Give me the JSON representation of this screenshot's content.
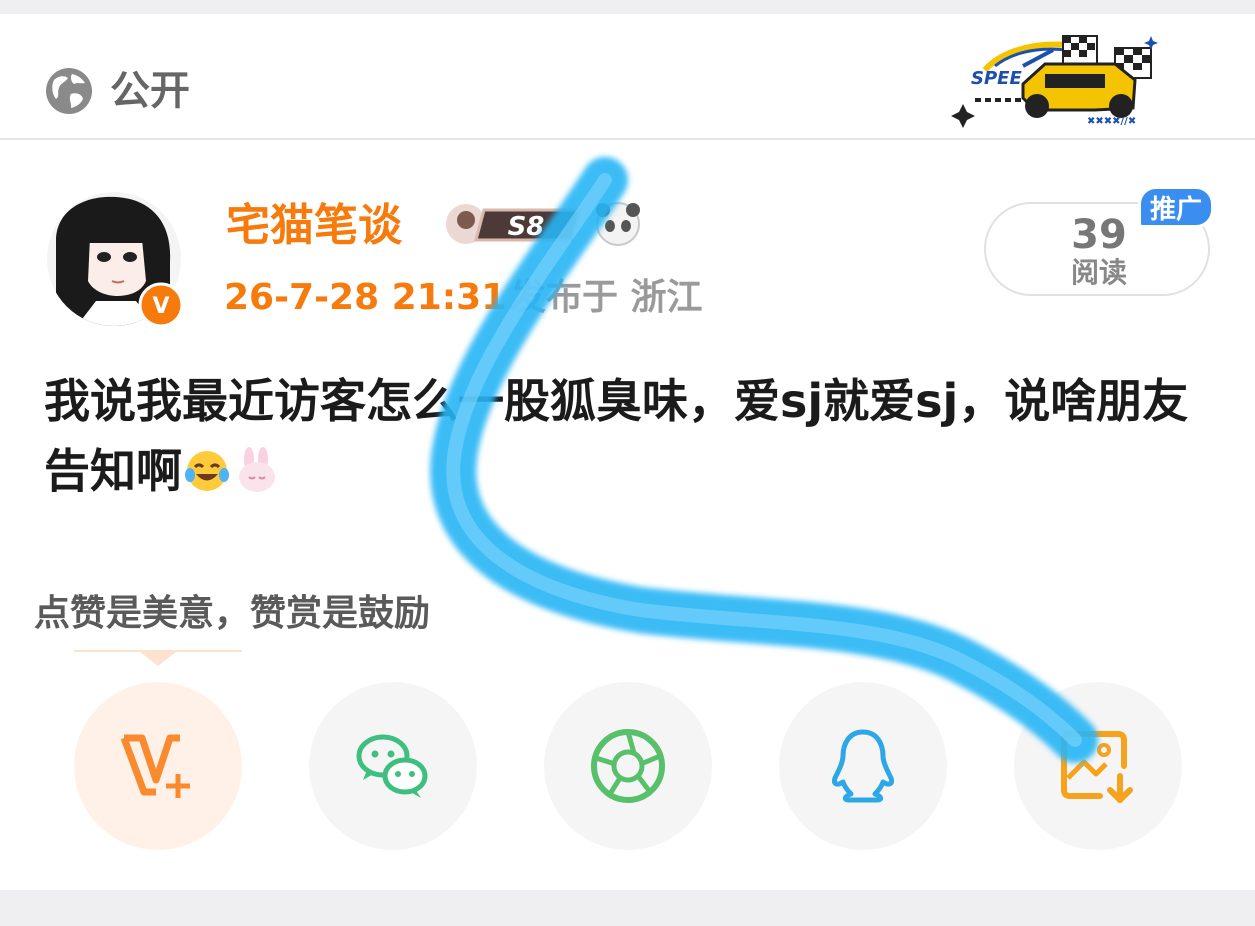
{
  "header": {
    "visibility_label": "公开",
    "globe_icon": "globe-icon",
    "logo_icon": "race-car-logo",
    "logo_text": "SPEE"
  },
  "author": {
    "name": "宅猫笔谈",
    "level_badge": "S8",
    "time": "26-7-28 21:31",
    "location": "发布于 浙江",
    "avatar_icon": "anime-girl-avatar",
    "verified_icon": "verified-v-badge",
    "verified_text": "V"
  },
  "stats": {
    "read_count": "39",
    "read_label": "阅读",
    "promo_tag": "推广"
  },
  "post": {
    "text": "我说我最近访客怎么一股狐臭味，爱sj就爱sj，说啥朋友告知啊"
  },
  "reward_hint": "点赞是美意，赞赏是鼓励",
  "share_buttons": [
    {
      "icon": "reward-v-plus-icon",
      "color": "#f98b2e"
    },
    {
      "icon": "wechat-icon",
      "color": "#3fbf7f"
    },
    {
      "icon": "moments-aperture-icon",
      "color": "#58c06b"
    },
    {
      "icon": "qq-icon",
      "color": "#2da7e6"
    },
    {
      "icon": "save-image-icon",
      "color": "#f7a21b"
    }
  ],
  "colors": {
    "accent_orange": "#f77a0c",
    "promo_blue": "#3a8ef0",
    "swipe_blue": "#27b5f5"
  }
}
